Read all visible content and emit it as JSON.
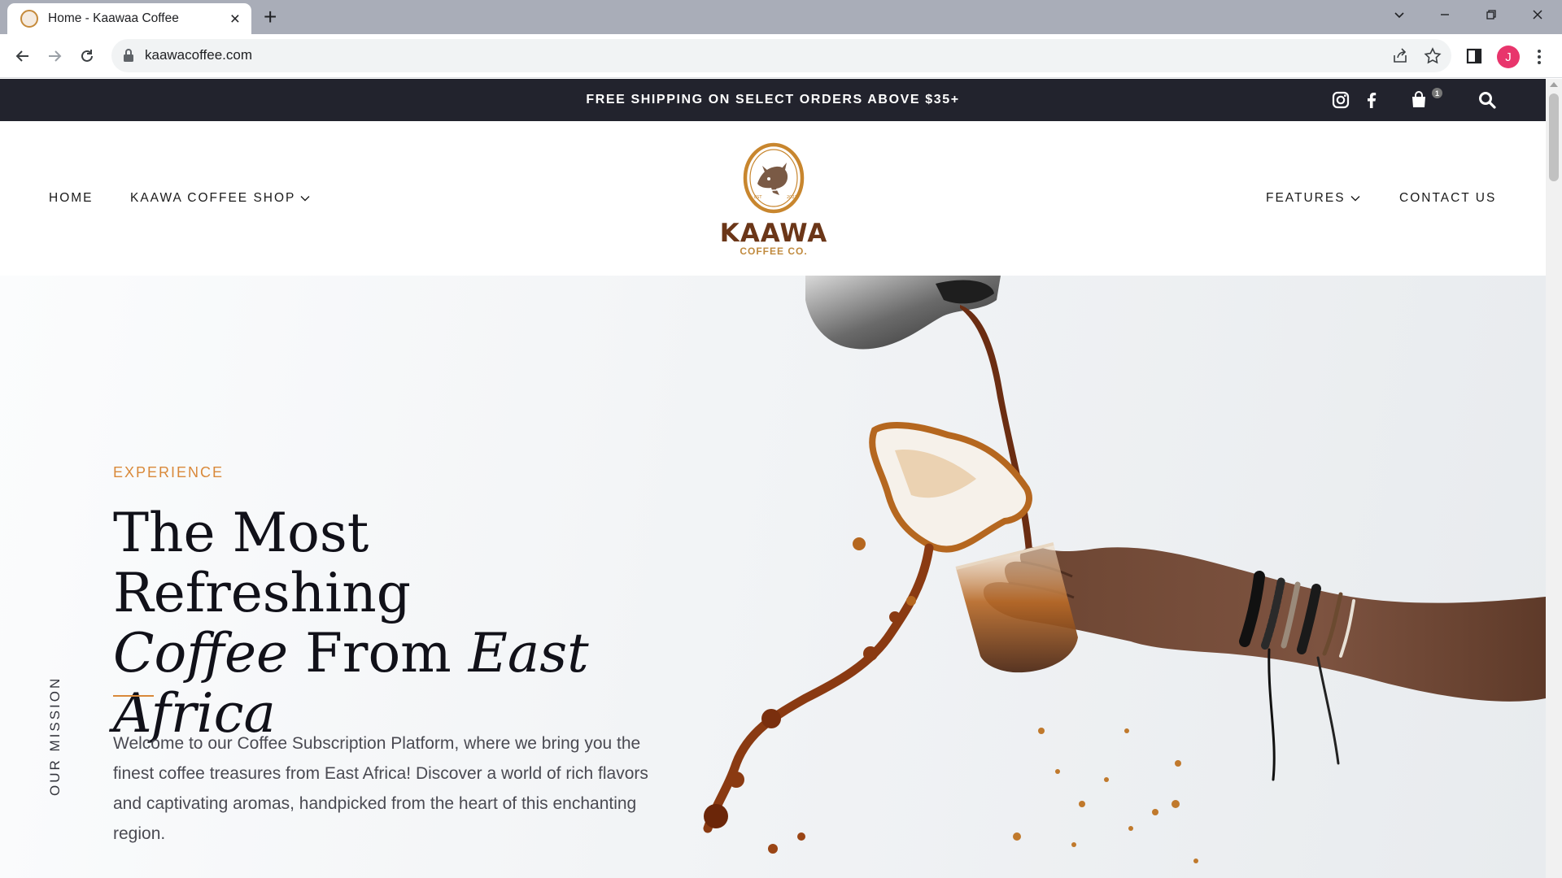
{
  "browser": {
    "tab_title": "Home - Kaawaa Coffee",
    "tab_close": "×",
    "new_tab": "+",
    "url": "kaawacoffee.com",
    "profile_initial": "J"
  },
  "announcement": {
    "message": "FREE SHIPPING ON SELECT ORDERS ABOVE $35+",
    "cart_count": "1"
  },
  "nav": {
    "home": "HOME",
    "shop": "KAAWA COFFEE SHOP",
    "features": "FEATURES",
    "contact": "CONTACT US"
  },
  "logo": {
    "word": "KAAWA",
    "sub": "COFFEE CO.",
    "est": "EST",
    "year": "2022"
  },
  "hero": {
    "eyebrow": "EXPERIENCE",
    "headline_1": "The Most Refreshing",
    "headline_2_em": "Coffee",
    "headline_2": " From ",
    "headline_2_em_b": "East",
    "headline_3_em": "Africa",
    "body": "Welcome to our Coffee Subscription Platform, where we bring you the finest coffee treasures from East Africa! Discover a world of rich flavors and captivating aromas, handpicked from the heart of this enchanting region.",
    "side_label": "OUR MISSION"
  },
  "colors": {
    "announce_bg": "#22232d",
    "accent": "#d9893a",
    "brand_brown": "#6b3618"
  }
}
